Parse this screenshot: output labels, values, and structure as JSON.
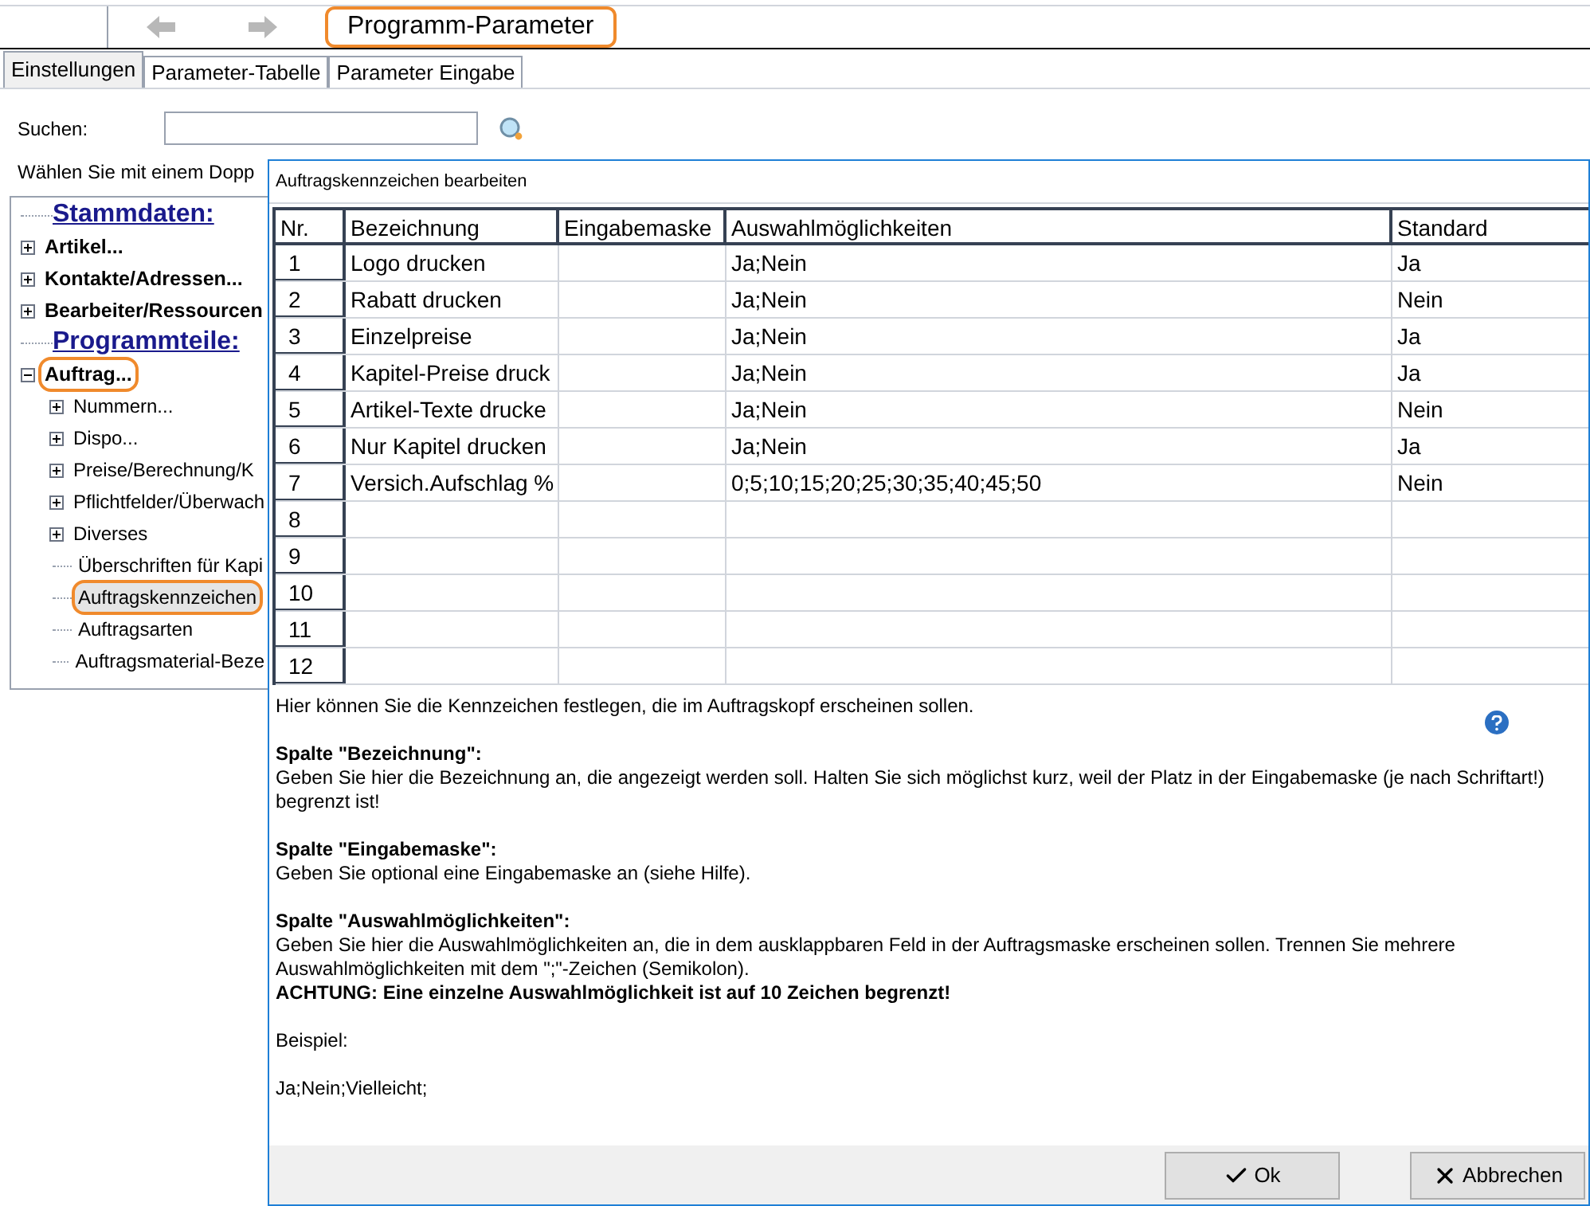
{
  "header": {
    "title": "Programm-Parameter",
    "title_highlighted": true
  },
  "tabs": [
    {
      "label": "Einstellungen",
      "selected": true
    },
    {
      "label": "Parameter-Tabelle",
      "selected": false
    },
    {
      "label": "Parameter Eingabe",
      "selected": false
    }
  ],
  "search": {
    "label": "Suchen:"
  },
  "hint": "Wählen Sie mit einem Dopp",
  "tree": [
    {
      "kind": "heading",
      "label": "Stammdaten:"
    },
    {
      "kind": "folder",
      "label": "Artikel...",
      "expanded": false,
      "highlighted": false
    },
    {
      "kind": "folder",
      "label": "Kontakte/Adressen...",
      "expanded": false,
      "highlighted": false
    },
    {
      "kind": "folder",
      "label": "Bearbeiter/Ressourcen",
      "expanded": false,
      "highlighted": false
    },
    {
      "kind": "heading",
      "label": "Programmteile:"
    },
    {
      "kind": "folder",
      "label": "Auftrag...",
      "expanded": true,
      "highlighted": true,
      "children": [
        {
          "kind": "folder",
          "label": "Nummern...",
          "expanded": false,
          "highlighted": false
        },
        {
          "kind": "folder",
          "label": "Dispo...",
          "expanded": false,
          "highlighted": false
        },
        {
          "kind": "folder",
          "label": "Preise/Berechnung/K",
          "expanded": false,
          "highlighted": false
        },
        {
          "kind": "folder",
          "label": "Pflichtfelder/Überwach",
          "expanded": false,
          "highlighted": false
        },
        {
          "kind": "folder",
          "label": "Diverses",
          "expanded": false,
          "highlighted": false
        },
        {
          "kind": "leaf",
          "label": "Überschriften für Kapi",
          "selected": false,
          "highlighted": false
        },
        {
          "kind": "leaf",
          "label": "Auftragskennzeichen",
          "selected": true,
          "highlighted": true
        },
        {
          "kind": "leaf",
          "label": "Auftragsarten",
          "selected": false,
          "highlighted": false
        },
        {
          "kind": "leaf",
          "label": "Auftragsmaterial-Beze",
          "selected": false,
          "highlighted": false
        }
      ]
    }
  ],
  "dialog": {
    "title": "Auftragskennzeichen bearbeiten",
    "table": {
      "columns": [
        "Nr.",
        "Bezeichnung",
        "Eingabemaske",
        "Auswahlmöglichkeiten",
        "Standard"
      ],
      "rows": [
        [
          "1",
          "Logo drucken",
          "",
          "Ja;Nein",
          "Ja"
        ],
        [
          "2",
          "Rabatt drucken",
          "",
          "Ja;Nein",
          "Nein"
        ],
        [
          "3",
          "Einzelpreise",
          "",
          "Ja;Nein",
          "Ja"
        ],
        [
          "4",
          "Kapitel-Preise druck",
          "",
          "Ja;Nein",
          "Ja"
        ],
        [
          "5",
          "Artikel-Texte drucke",
          "",
          "Ja;Nein",
          "Nein"
        ],
        [
          "6",
          "Nur Kapitel drucken",
          "",
          "Ja;Nein",
          "Ja"
        ],
        [
          "7",
          "Versich.Aufschlag %",
          "",
          "0;5;10;15;20;25;30;35;40;45;50",
          "Nein"
        ],
        [
          "8",
          "",
          "",
          "",
          ""
        ],
        [
          "9",
          "",
          "",
          "",
          ""
        ],
        [
          "10",
          "",
          "",
          "",
          ""
        ],
        [
          "11",
          "",
          "",
          "",
          ""
        ],
        [
          "12",
          "",
          "",
          "",
          ""
        ]
      ]
    },
    "help": [
      {
        "kind": "text",
        "text": "Hier können Sie die Kennzeichen festlegen, die im Auftragskopf erscheinen sollen."
      },
      {
        "kind": "gap"
      },
      {
        "kind": "heading",
        "text": "Spalte \"Bezeichnung\":"
      },
      {
        "kind": "text",
        "text": "Geben Sie hier die Bezeichnung an, die angezeigt werden soll. Halten Sie sich möglichst kurz, weil der Platz in der Eingabemaske (je nach Schriftart!) begrenzt ist!"
      },
      {
        "kind": "gap"
      },
      {
        "kind": "heading",
        "text": "Spalte \"Eingabemaske\":"
      },
      {
        "kind": "text",
        "text": "Geben Sie optional eine Eingabemaske an (siehe Hilfe)."
      },
      {
        "kind": "gap"
      },
      {
        "kind": "heading",
        "text": "Spalte \"Auswahlmöglichkeiten\":"
      },
      {
        "kind": "text",
        "text": "Geben Sie hier die Auswahlmöglichkeiten an, die in dem ausklappbaren Feld in der Auftragsmaske erscheinen sollen. Trennen Sie mehrere Auswahlmöglichkeiten mit dem \";\"-Zeichen (Semikolon)."
      },
      {
        "kind": "heading",
        "text": "ACHTUNG: Eine einzelne  Auswahlmöglichkeit ist auf 10 Zeichen begrenzt!"
      },
      {
        "kind": "gap"
      },
      {
        "kind": "text",
        "text": "Beispiel:"
      },
      {
        "kind": "gap"
      },
      {
        "kind": "text",
        "text": "Ja;Nein;Vielleicht;"
      }
    ],
    "buttons": [
      {
        "kind": "ok",
        "label": "Ok"
      },
      {
        "kind": "cancel",
        "label": "Abbrechen"
      }
    ]
  }
}
